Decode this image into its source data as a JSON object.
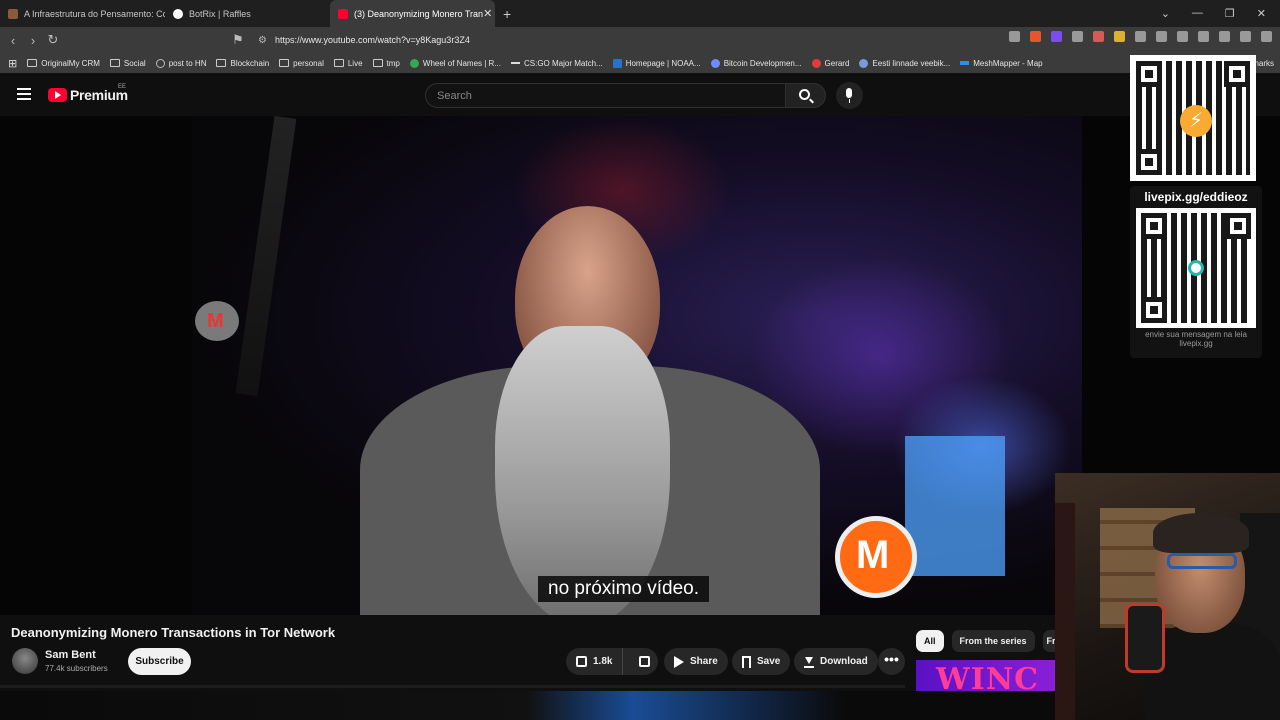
{
  "browser": {
    "tabs": [
      {
        "title": "A Infraestrutura do Pensamento: Co",
        "color": "#8a5a3a"
      },
      {
        "title": "BotRix | Raffles",
        "color": "#ffffff"
      },
      {
        "title": "(3) Deanonymizing Monero Tran",
        "color": "#ff0033"
      }
    ],
    "new_tab": "+",
    "url": "https://www.youtube.com/watch?v=y8Kagu3r3Z4",
    "bookmarks": [
      {
        "label": "OriginalMy CRM",
        "type": "folder"
      },
      {
        "label": "Social",
        "type": "folder"
      },
      {
        "label": "post to HN",
        "type": "site",
        "color": "#bbbbbb"
      },
      {
        "label": "Blockchain",
        "type": "folder"
      },
      {
        "label": "personal",
        "type": "folder"
      },
      {
        "label": "Live",
        "type": "folder"
      },
      {
        "label": "tmp",
        "type": "folder"
      },
      {
        "label": "Wheel of Names | R...",
        "type": "site",
        "color": "#34a853"
      },
      {
        "label": "CS:GO Major Match...",
        "type": "site",
        "color": "#dddddd"
      },
      {
        "label": "Homepage | NOAA...",
        "type": "site",
        "color": "#2a6fd6"
      },
      {
        "label": "Bitcoin Developmen...",
        "type": "site",
        "color": "#6a8cff"
      },
      {
        "label": "Gerard",
        "type": "site",
        "color": "#e33b3b"
      },
      {
        "label": "Eesti linnade veebik...",
        "type": "site",
        "color": "#7a9ad8"
      },
      {
        "label": "MeshMapper - Map",
        "type": "site",
        "color": "#2d8cf0"
      }
    ],
    "bookmarks_overflow": "marks"
  },
  "youtube": {
    "logo_text": "Premium",
    "country_code": "EE",
    "search_placeholder": "Search"
  },
  "video": {
    "subtitle": "no próximo vídeo.",
    "title": "Deanonymizing Monero Transactions in Tor Network",
    "channel": "Sam Bent",
    "subscribers": "77.4k subscribers",
    "subscribe_label": "Subscribe",
    "likes": "1.8k",
    "share_label": "Share",
    "save_label": "Save",
    "download_label": "Download",
    "more_label": "•••"
  },
  "overlay": {
    "livepix_label": "livepix.gg/eddieoz",
    "livepix_hint": "envie sua mensagem na leia livepix.gg"
  },
  "sidebar": {
    "chips": [
      "All",
      "From the series",
      "Fro"
    ],
    "promo_text": "WINC"
  }
}
